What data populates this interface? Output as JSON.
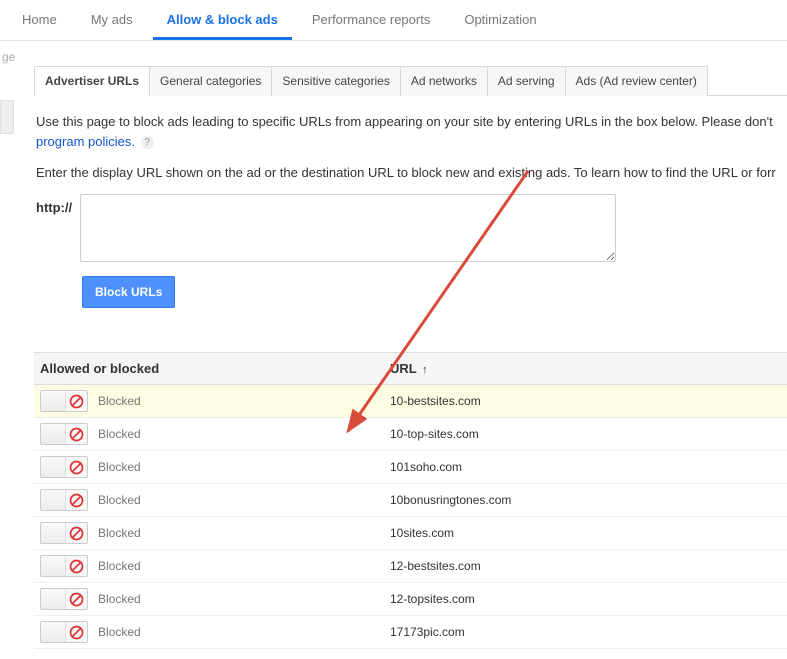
{
  "topnav": {
    "items": [
      {
        "label": "Home",
        "active": false
      },
      {
        "label": "My ads",
        "active": false
      },
      {
        "label": "Allow & block ads",
        "active": true
      },
      {
        "label": "Performance reports",
        "active": false
      },
      {
        "label": "Optimization",
        "active": false
      }
    ]
  },
  "sidebar_fragment": {
    "text": "ge"
  },
  "subtabs": {
    "items": [
      {
        "label": "Advertiser URLs",
        "active": true
      },
      {
        "label": "General categories",
        "active": false
      },
      {
        "label": "Sensitive categories",
        "active": false
      },
      {
        "label": "Ad networks",
        "active": false
      },
      {
        "label": "Ad serving",
        "active": false
      },
      {
        "label": "Ads (Ad review center)",
        "active": false
      }
    ]
  },
  "text": {
    "desc_part1": "Use this page to block ads leading to specific URLs from appearing on your site by entering URLs in the box below. Please don't ",
    "policies_link": "program policies.",
    "desc2": "Enter the display URL shown on the ad or the destination URL to block new and existing ads. To learn how to find the URL or forr",
    "http_label": "http://",
    "block_btn": "Block URLs"
  },
  "table": {
    "header_status": "Allowed or blocked",
    "header_url": "URL",
    "sort_indicator": "↑",
    "rows": [
      {
        "status": "Blocked",
        "url": "10-bestsites.com",
        "highlight": true
      },
      {
        "status": "Blocked",
        "url": "10-top-sites.com",
        "highlight": false
      },
      {
        "status": "Blocked",
        "url": "101soho.com",
        "highlight": false
      },
      {
        "status": "Blocked",
        "url": "10bonusringtones.com",
        "highlight": false
      },
      {
        "status": "Blocked",
        "url": "10sites.com",
        "highlight": false
      },
      {
        "status": "Blocked",
        "url": "12-bestsites.com",
        "highlight": false
      },
      {
        "status": "Blocked",
        "url": "12-topsites.com",
        "highlight": false
      },
      {
        "status": "Blocked",
        "url": "17173pic.com",
        "highlight": false
      }
    ]
  }
}
